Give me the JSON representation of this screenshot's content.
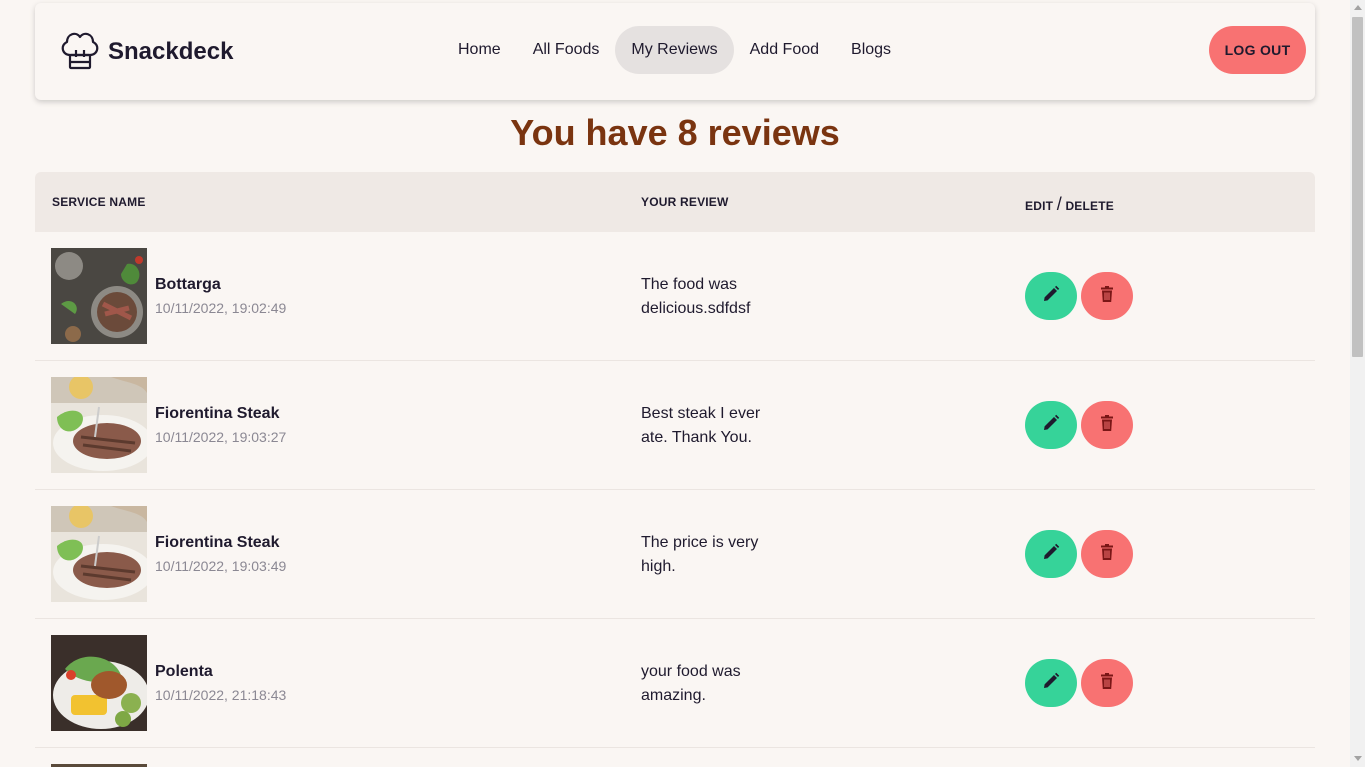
{
  "brand": {
    "name": "Snackdeck",
    "icon": "chef-hat-icon"
  },
  "nav": {
    "items": [
      {
        "label": "Home",
        "active": false
      },
      {
        "label": "All Foods",
        "active": false
      },
      {
        "label": "My Reviews",
        "active": true
      },
      {
        "label": "Add Food",
        "active": false
      },
      {
        "label": "Blogs",
        "active": false
      }
    ],
    "logout_label": "LOG OUT"
  },
  "heading": "You have 8 reviews",
  "table": {
    "headers": {
      "service": "SERVICE NAME",
      "review": "YOUR REVIEW",
      "edit": "EDIT",
      "slash": "/",
      "delete": "DELETE"
    },
    "rows": [
      {
        "name": "Bottarga",
        "date": "10/11/2022, 19:02:49",
        "review": "The food was delicious.sdfdsf"
      },
      {
        "name": "Fiorentina Steak",
        "date": "10/11/2022, 19:03:27",
        "review": "Best steak I ever ate. Thank You."
      },
      {
        "name": "Fiorentina Steak",
        "date": "10/11/2022, 19:03:49",
        "review": "The price is very high."
      },
      {
        "name": "Polenta",
        "date": "10/11/2022, 21:18:43",
        "review": "your food was amazing."
      }
    ]
  },
  "colors": {
    "accent_red": "#f87272",
    "accent_green": "#36d399",
    "heading": "#7a3410",
    "background": "#faf6f3"
  },
  "icons": {
    "edit": "pencil-icon",
    "delete": "trash-icon"
  }
}
